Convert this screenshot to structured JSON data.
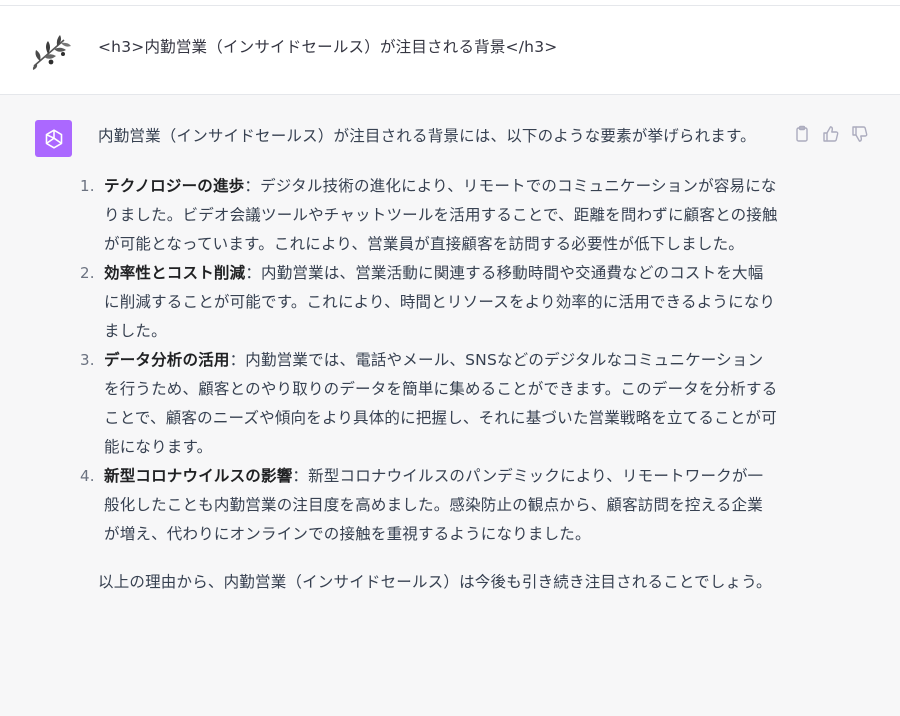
{
  "user_message": {
    "text": "<h3>内勤営業（インサイドセールス）が注目される背景</h3>"
  },
  "assistant_message": {
    "intro": "内勤営業（インサイドセールス）が注目される背景には、以下のような要素が挙げられます。",
    "items": [
      {
        "number": "1.",
        "title": "テクノロジーの進歩",
        "body": "：デジタル技術の進化により、リモートでのコミュニケーションが容易になりました。ビデオ会議ツールやチャットツールを活用することで、距離を問わずに顧客との接触が可能となっています。これにより、営業員が直接顧客を訪問する必要性が低下しました。"
      },
      {
        "number": "2.",
        "title": "効率性とコスト削減",
        "body": "：内勤営業は、営業活動に関連する移動時間や交通費などのコストを大幅に削減することが可能です。これにより、時間とリソースをより効率的に活用できるようになりました。"
      },
      {
        "number": "3.",
        "title": "データ分析の活用",
        "body": "：内勤営業では、電話やメール、SNSなどのデジタルなコミュニケーションを行うため、顧客とのやり取りのデータを簡単に集めることができます。このデータを分析することで、顧客のニーズや傾向をより具体的に把握し、それに基づいた営業戦略を立てることが可能になります。"
      },
      {
        "number": "4.",
        "title": "新型コロナウイルスの影響",
        "body": "：新型コロナウイルスのパンデミックにより、リモートワークが一般化したことも内勤営業の注目度を高めました。感染防止の観点から、顧客訪問を控える企業が増え、代わりにオンラインでの接触を重視するようになりました。"
      }
    ],
    "outro": "以上の理由から、内勤営業（インサイドセールス）は今後も引き続き注目されることでしょう。"
  },
  "icons": {
    "user_avatar": "olive-branch-avatar",
    "assistant_avatar": "openai-logo-icon",
    "copy": "clipboard-icon",
    "like": "thumbs-up-icon",
    "dislike": "thumbs-down-icon"
  },
  "colors": {
    "assistant_avatar_bg": "#ab68ff",
    "assistant_row_bg": "#f7f7f8"
  }
}
